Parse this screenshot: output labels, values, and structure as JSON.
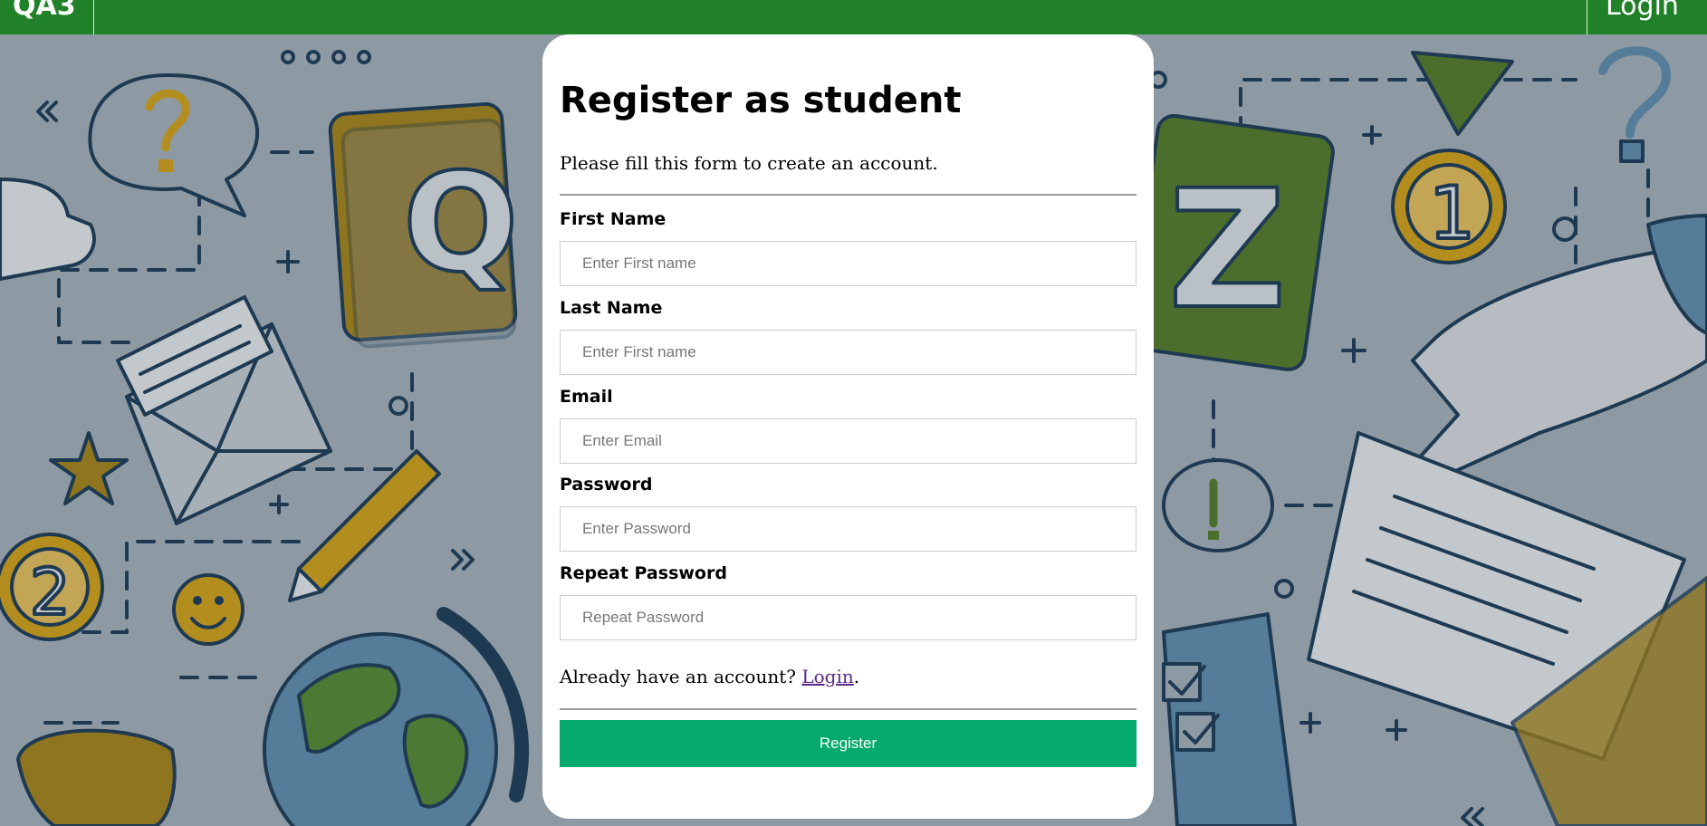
{
  "navbar": {
    "brand": "QA3",
    "login_label": "Login",
    "color": "#218129"
  },
  "form": {
    "title": "Register as student",
    "subtitle": "Please fill this form to create an account.",
    "fields": [
      {
        "label": "First Name",
        "placeholder": "Enter First name",
        "value": ""
      },
      {
        "label": "Last Name",
        "placeholder": "Enter First name",
        "value": ""
      },
      {
        "label": "Email",
        "placeholder": "Enter Email",
        "value": ""
      },
      {
        "label": "Password",
        "placeholder": "Enter Password",
        "value": ""
      },
      {
        "label": "Repeat Password",
        "placeholder": "Repeat Password",
        "value": ""
      }
    ],
    "account_prompt": "Already have an account?",
    "login_link": "Login",
    "period": ".",
    "register_label": "Register",
    "register_color": "#04aa6d"
  }
}
